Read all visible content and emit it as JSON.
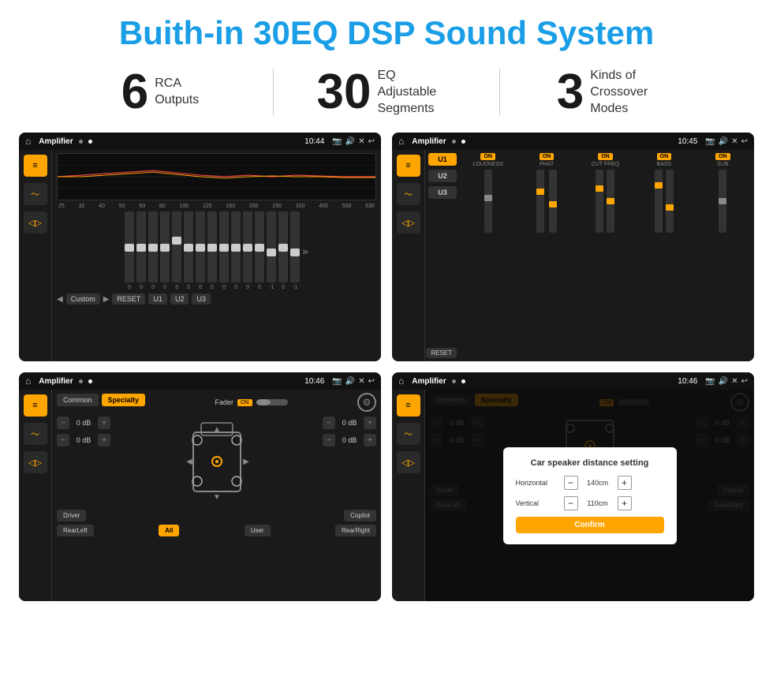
{
  "header": {
    "title": "Buith-in 30EQ DSP Sound System"
  },
  "stats": [
    {
      "number": "6",
      "label_line1": "RCA",
      "label_line2": "Outputs"
    },
    {
      "number": "30",
      "label_line1": "EQ Adjustable",
      "label_line2": "Segments"
    },
    {
      "number": "3",
      "label_line1": "Kinds of",
      "label_line2": "Crossover Modes"
    }
  ],
  "screens": [
    {
      "id": "screen1",
      "app_title": "Amplifier",
      "time": "10:44",
      "type": "eq"
    },
    {
      "id": "screen2",
      "app_title": "Amplifier",
      "time": "10:45",
      "type": "amp2"
    },
    {
      "id": "screen3",
      "app_title": "Amplifier",
      "time": "10:46",
      "type": "crossover"
    },
    {
      "id": "screen4",
      "app_title": "Amplifier",
      "time": "10:46",
      "type": "crossover_dialog"
    }
  ],
  "eq": {
    "freqs": [
      "25",
      "32",
      "40",
      "50",
      "63",
      "80",
      "100",
      "125",
      "160",
      "200",
      "250",
      "320",
      "400",
      "500",
      "630"
    ],
    "values": [
      "0",
      "0",
      "0",
      "0",
      "5",
      "0",
      "0",
      "0",
      "0",
      "0",
      "0",
      "0",
      "-1",
      "0",
      "-1"
    ],
    "preset": "Custom",
    "buttons": [
      "RESET",
      "U1",
      "U2",
      "U3"
    ]
  },
  "amp2": {
    "presets": [
      "U1",
      "U2",
      "U3"
    ],
    "controls": [
      {
        "name": "LOUDNESS",
        "on": true
      },
      {
        "name": "PHAT",
        "on": true
      },
      {
        "name": "CUT FREQ",
        "on": true
      },
      {
        "name": "BASS",
        "on": true
      },
      {
        "name": "SUB",
        "on": true
      }
    ],
    "reset_label": "RESET"
  },
  "crossover": {
    "tabs": [
      "Common",
      "Specialty"
    ],
    "active_tab": "Specialty",
    "fader_label": "Fader",
    "fader_on": "ON",
    "vol_rows": [
      {
        "label": "0 dB"
      },
      {
        "label": "0 dB"
      }
    ],
    "vol_rows_right": [
      {
        "label": "0 dB"
      },
      {
        "label": "0 dB"
      }
    ],
    "nav_buttons": [
      "Driver",
      "Copilot",
      "RearLeft",
      "All",
      "User",
      "RearRight"
    ]
  },
  "dialog": {
    "title": "Car speaker distance setting",
    "horizontal_label": "Horizontal",
    "horizontal_value": "140cm",
    "vertical_label": "Vertical",
    "vertical_value": "110cm",
    "confirm_label": "Confirm",
    "vol_right_1": "0 dB",
    "vol_right_2": "0 dB"
  }
}
